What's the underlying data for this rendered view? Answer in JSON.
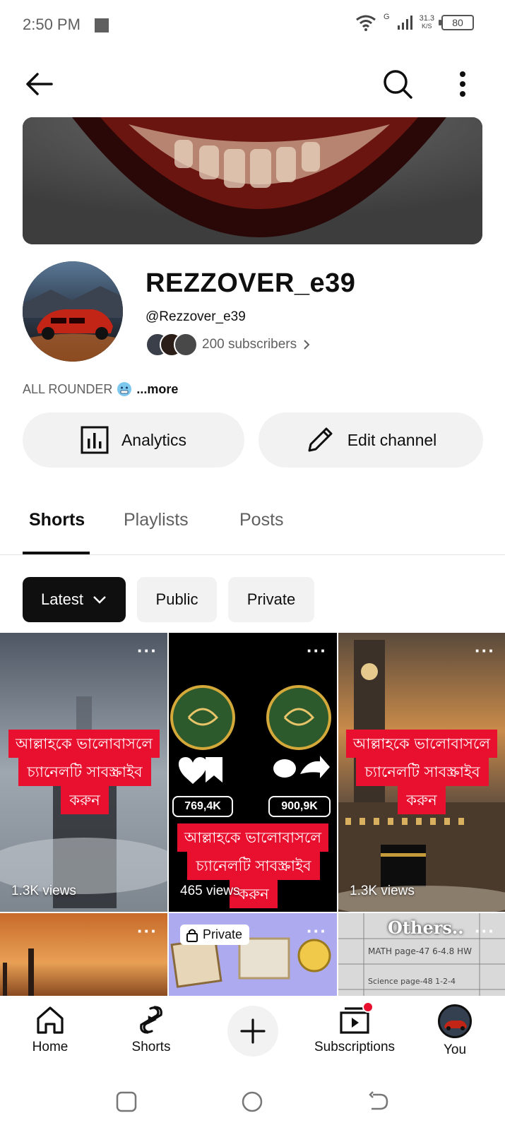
{
  "status_bar": {
    "time": "2:50 PM",
    "network_type": "G",
    "net_speed_value": "31.3",
    "net_speed_unit": "K/S",
    "battery": "80"
  },
  "channel": {
    "title": "REZZOVER_e39",
    "handle": "@Rezzover_e39",
    "subscribers": "200 subscribers",
    "bio": "ALL ROUNDER",
    "bio_more": "...more"
  },
  "actions": {
    "analytics_label": "Analytics",
    "edit_label": "Edit channel"
  },
  "tabs": [
    {
      "label": "Shorts",
      "active": true
    },
    {
      "label": "Playlists",
      "active": false
    },
    {
      "label": "Posts",
      "active": false
    }
  ],
  "chips": {
    "latest": "Latest",
    "public": "Public",
    "private": "Private"
  },
  "shorts": [
    {
      "caption_line1": "আল্লাহকে ভালোবাসলে",
      "caption_line2": "চ্যানেলটি সাবস্ক্রাইব",
      "caption_line3": "করুন",
      "views": "1.3K views"
    },
    {
      "likes": "769,4K",
      "comments": "900,9K",
      "caption_line1": "আল্লাহকে ভালোবাসলে",
      "caption_line2": "চ্যানেলটি সাবস্ক্রাইব",
      "caption_line3": "করুন",
      "views": "465 views"
    },
    {
      "caption_line1": "আল্লাহকে ভালোবাসলে",
      "caption_line2": "চ্যানেলটি সাবস্ক্রাইব",
      "caption_line3": "করুন",
      "views": "1.3K views"
    },
    {},
    {
      "private_label": "Private"
    },
    {
      "overlay_text": "Others.."
    }
  ],
  "bottom_nav": {
    "home": "Home",
    "shorts": "Shorts",
    "subscriptions": "Subscriptions",
    "you": "You"
  },
  "colors": {
    "caption_red": "#e8102e",
    "notification_dot": "#e8102e",
    "selected_chip": "#0f0f0f"
  }
}
